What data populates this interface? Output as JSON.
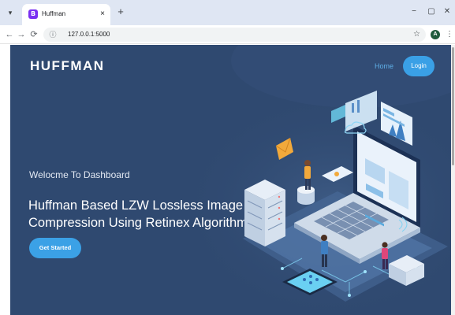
{
  "browser": {
    "tab": {
      "favicon_letter": "B",
      "title": "Huffman",
      "close": "×"
    },
    "new_tab": "+",
    "tab_list": "▾",
    "window": {
      "minimize": "−",
      "maximize": "▢",
      "close": "✕"
    },
    "toolbar": {
      "back": "←",
      "forward": "→",
      "reload": "⟳",
      "site_info": "ⓘ",
      "url": "127.0.0.1:5000",
      "bookmark": "☆",
      "profile_initial": "A",
      "menu": "⋮"
    }
  },
  "site": {
    "brand": "HUFFMAN",
    "nav": {
      "home": "Home",
      "login": "Login"
    },
    "hero": {
      "welcome": "Welocme To Dashboard",
      "headline": "Huffman Based LZW Lossless Image Compression Using Retinex Algorithm",
      "cta": "Get Started",
      "illustration": "isometric-laptop-data-illustration"
    }
  },
  "colors": {
    "page_background": "#2f4970",
    "accent": "#3aa0e6",
    "nav_link": "#5fb0e8",
    "tab_bar": "#dfe6f3"
  }
}
